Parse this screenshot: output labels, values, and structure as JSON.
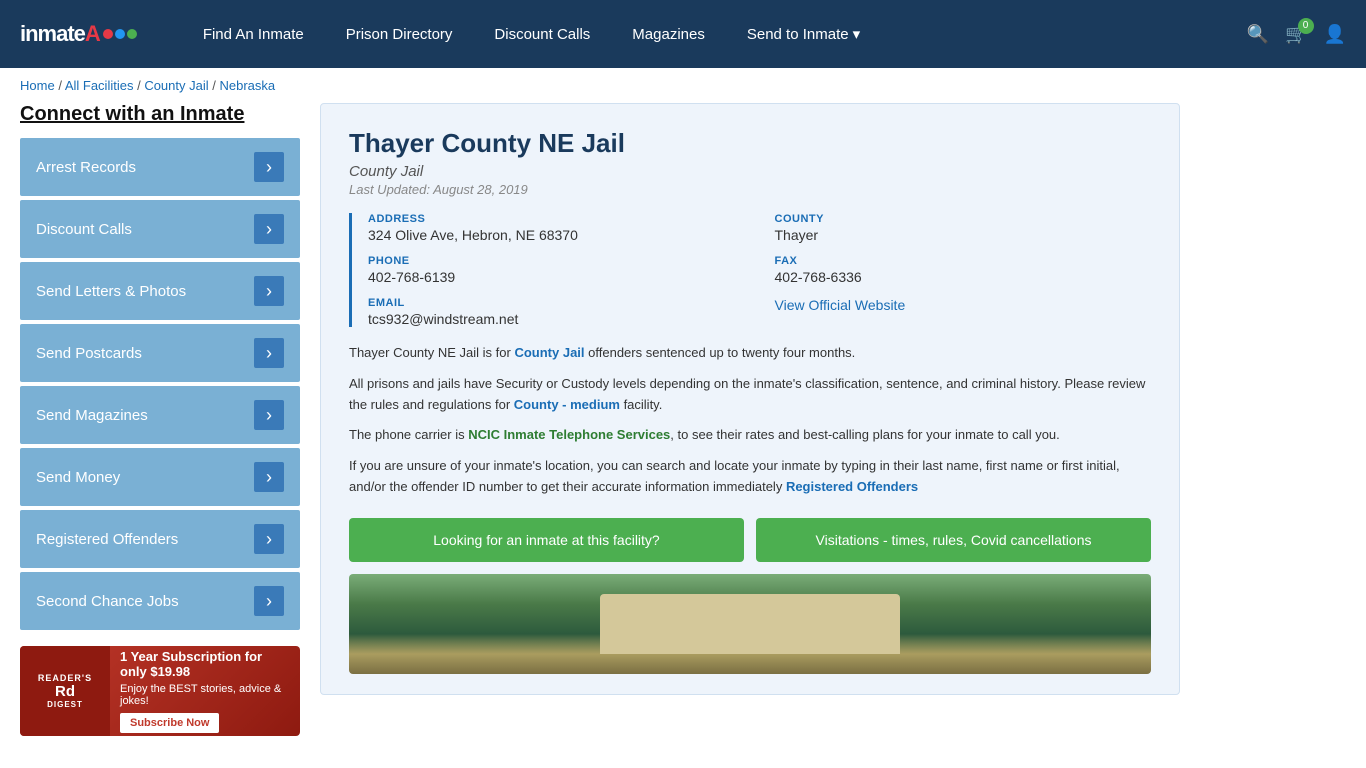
{
  "header": {
    "logo_text": "inmateA",
    "nav": [
      {
        "label": "Find An Inmate",
        "id": "find-inmate"
      },
      {
        "label": "Prison Directory",
        "id": "prison-directory"
      },
      {
        "label": "Discount Calls",
        "id": "discount-calls"
      },
      {
        "label": "Magazines",
        "id": "magazines"
      },
      {
        "label": "Send to Inmate",
        "id": "send-to-inmate",
        "dropdown": true
      }
    ],
    "cart_count": "0",
    "icons": {
      "search": "🔍",
      "cart": "🛒",
      "user": "👤"
    }
  },
  "breadcrumb": {
    "items": [
      "Home",
      "All Facilities",
      "County Jail",
      "Nebraska"
    ]
  },
  "sidebar": {
    "title": "Connect with an Inmate",
    "items": [
      {
        "label": "Arrest Records",
        "id": "arrest-records"
      },
      {
        "label": "Discount Calls",
        "id": "discount-calls"
      },
      {
        "label": "Send Letters & Photos",
        "id": "send-letters"
      },
      {
        "label": "Send Postcards",
        "id": "send-postcards"
      },
      {
        "label": "Send Magazines",
        "id": "send-magazines"
      },
      {
        "label": "Send Money",
        "id": "send-money"
      },
      {
        "label": "Registered Offenders",
        "id": "registered-offenders"
      },
      {
        "label": "Second Chance Jobs",
        "id": "second-chance-jobs"
      }
    ],
    "ad": {
      "brand": "READER'S DIGEST",
      "title": "1 Year Subscription for only $19.98",
      "sub": "Enjoy the BEST stories, advice & jokes!",
      "button": "Subscribe Now"
    }
  },
  "facility": {
    "title": "Thayer County NE Jail",
    "type": "County Jail",
    "last_updated": "Last Updated: August 28, 2019",
    "address_label": "ADDRESS",
    "address_value": "324 Olive Ave, Hebron, NE 68370",
    "county_label": "COUNTY",
    "county_value": "Thayer",
    "phone_label": "PHONE",
    "phone_value": "402-768-6139",
    "fax_label": "FAX",
    "fax_value": "402-768-6336",
    "email_label": "EMAIL",
    "email_value": "tcs932@windstream.net",
    "website_label": "View Official Website",
    "website_url": "#",
    "desc1": "Thayer County NE Jail is for ",
    "desc1_link": "County Jail",
    "desc1_end": " offenders sentenced up to twenty four months.",
    "desc2": "All prisons and jails have Security or Custody levels depending on the inmate's classification, sentence, and criminal history. Please review the rules and regulations for ",
    "desc2_link": "County - medium",
    "desc2_end": " facility.",
    "desc3": "The phone carrier is ",
    "desc3_link": "NCIC Inmate Telephone Services",
    "desc3_end": ", to see their rates and best-calling plans for your inmate to call you.",
    "desc4": "If you are unsure of your inmate's location, you can search and locate your inmate by typing in their last name, first name or first initial, and/or the offender ID number to get their accurate information immediately ",
    "desc4_link": "Registered Offenders",
    "btn1": "Looking for an inmate at this facility?",
    "btn2": "Visitations - times, rules, Covid cancellations"
  }
}
